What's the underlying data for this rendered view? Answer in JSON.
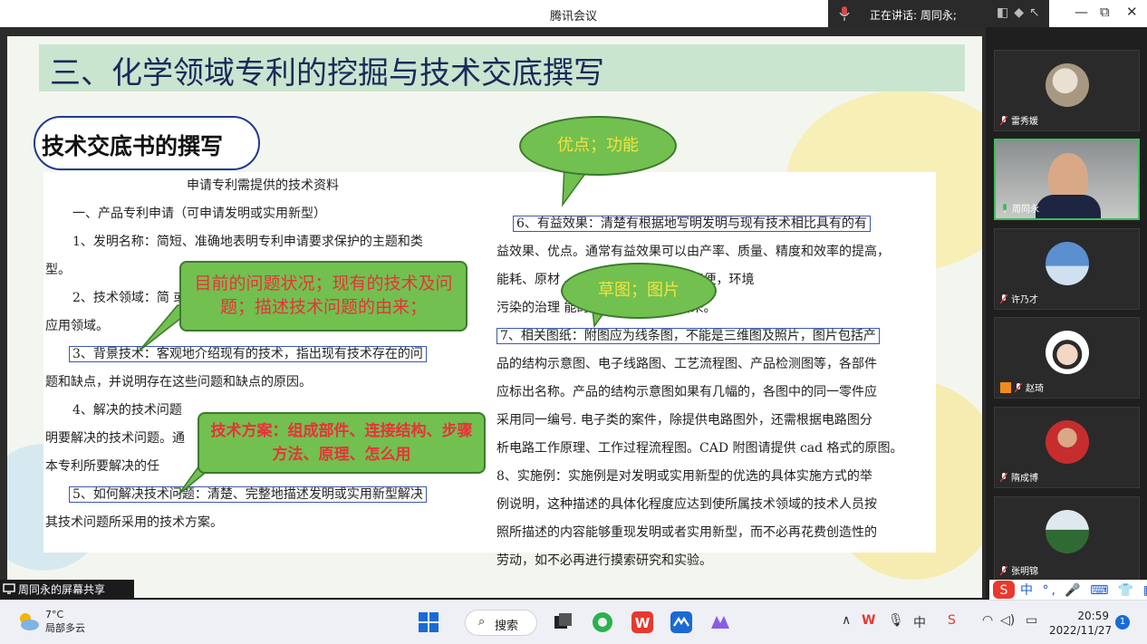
{
  "window": {
    "title": "腾讯会议",
    "speaking_label": "正在讲话: 周同永;"
  },
  "slide": {
    "title": "三、化学领域专利的挖掘与技术交底撰写",
    "subtitle": "技术交底书的撰写",
    "left_lines": [
      "申请专利需提供的技术资料",
      "一、产品专利申请（可申请发明或实用新型）",
      "1、发明名称：简短、准确地表明专利申请要求保护的主题和类",
      "型。",
      "2、技术领域：简                                                       或",
      "应用领域。",
      "3、背景技术：客观地介绍现有的技术，指出现有技术存在的问",
      "题和缺点，并说明存在这些问题和缺点的原因。",
      "4、解决的技术问题",
      "明要解决的技术问题。通",
      "本专利所要解决的任",
      "5、如何解决技术问题：清楚、完整地描述发明或实用新型解决",
      "其技术问题所采用的技术方案。"
    ],
    "right_lines": [
      "6、有益效果：清楚有根据地写明发明与现有技术相比具有的有",
      "益效果、优点。通常有益效果可以由产率、质量、精度和效率的提高，",
      "能耗、原材                       、操作、控制、使用的简便，环境",
      "污染的治理                       能的出现等方面反映出来。",
      "7、相关图纸：附图应为线条图，不能是三维图及照片，图片包括产",
      "品的结构示意图、电子线路图、工艺流程图、产品检测图等，各部件",
      "应标出名称。产品的结构示意图如果有几幅的，各图中的同一零件应",
      "采用同一编号. 电子类的案件，除提供电路图外，还需根据电路图分",
      "析电路工作原理、工作过程流程图。CAD 附图请提供 cad 格式的原图。",
      "8、实施例：实施例是对发明或实用新型的优选的具体实施方式的举",
      "例说明，这种描述的具体化程度应达到使所属技术领域的技术人员按",
      "照所描述的内容能够重现发明或者实用新型，而不必再花费创造性的",
      "劳动，如不必再进行摸索研究和实验。"
    ],
    "callouts": {
      "problem": "目前的问题状况；现有的技术及问题；描述技术问题的由来；",
      "scheme": "技术方案：组成部件、连接结构、步骤方法、原理、怎么用",
      "advantage": "优点；功能",
      "drawing": "草图；图片"
    }
  },
  "participants": [
    {
      "name": "雷秀媛"
    },
    {
      "name": "周同永"
    },
    {
      "name": "许乃才"
    },
    {
      "name": "赵琦"
    },
    {
      "name": "隋成博"
    },
    {
      "name": "张明锦"
    }
  ],
  "share_label": "周同永的屏幕共享",
  "ime": "中 °, 🎤 ⌨ 👕 ▦",
  "taskbar": {
    "temperature": "7°C",
    "weather": "局部多云",
    "search": "搜索",
    "time": "20:59",
    "date": "2022/11/27",
    "notifications": "1"
  },
  "colors": {
    "accent_green": "#72c04f",
    "active_border": "#3cbf5a",
    "title_band": "#c9e5cf",
    "pill_border": "#1f3b8f"
  }
}
